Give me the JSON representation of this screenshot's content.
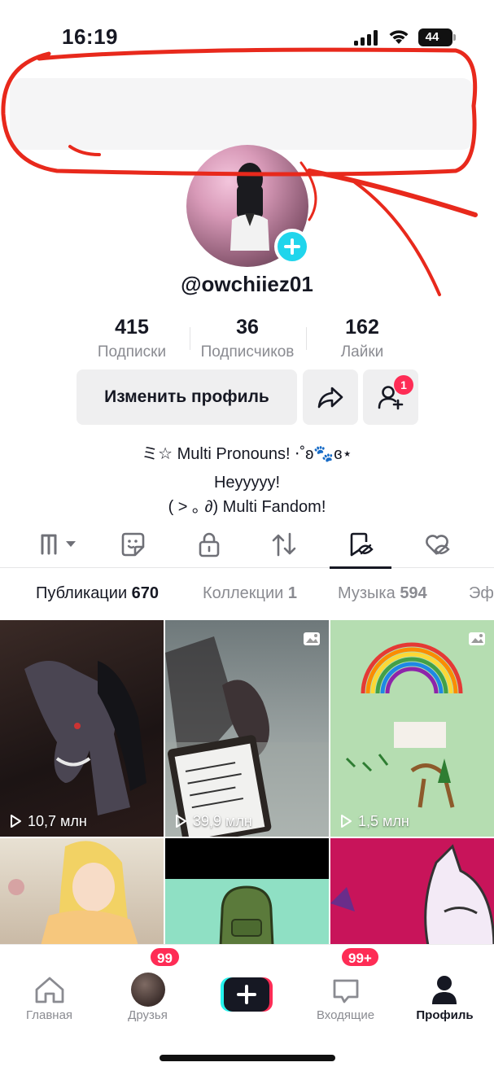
{
  "status_bar": {
    "time": "16:19",
    "battery": "44"
  },
  "profile": {
    "username": "@owchiiez01",
    "stats": [
      {
        "value": "415",
        "label": "Подписки"
      },
      {
        "value": "36",
        "label": "Подписчиков"
      },
      {
        "value": "162",
        "label": "Лайки"
      }
    ],
    "edit_button": "Изменить профиль",
    "friend_requests_badge": "1",
    "bio": [
      "ミ☆ Multi Pronouns! ⋅˚ʚ🐾ɞ⋆",
      "Heyyyyy!",
      "( ˃ ｡ ∂) Multi Fandom!"
    ]
  },
  "icon_tabs": [
    "grid-icon",
    "sticker-icon",
    "lock-icon",
    "repost-icon",
    "liked-hidden-icon",
    "favorites-hidden-icon"
  ],
  "sub_tabs": [
    {
      "label": "Публикации",
      "count": "670"
    },
    {
      "label": "Коллекции",
      "count": "1"
    },
    {
      "label": "Музыка",
      "count": "594"
    },
    {
      "label": "Эф",
      "count": ""
    }
  ],
  "posts": [
    {
      "views": "10,7 млн",
      "photo": false
    },
    {
      "views": "39,9 млн",
      "photo": true
    },
    {
      "views": "1,5 млн",
      "photo": true
    },
    {
      "views": "",
      "photo": false
    },
    {
      "views": "",
      "photo": false
    },
    {
      "views": "",
      "photo": false
    }
  ],
  "bottom_nav": {
    "home": "Главная",
    "friends": "Друзья",
    "friends_badge": "99",
    "inbox": "Входящие",
    "inbox_badge": "99+",
    "profile": "Профиль"
  },
  "colors": {
    "accent": "#fe2c55",
    "cyan": "#20d5ec",
    "annotation": "#e8291c"
  }
}
